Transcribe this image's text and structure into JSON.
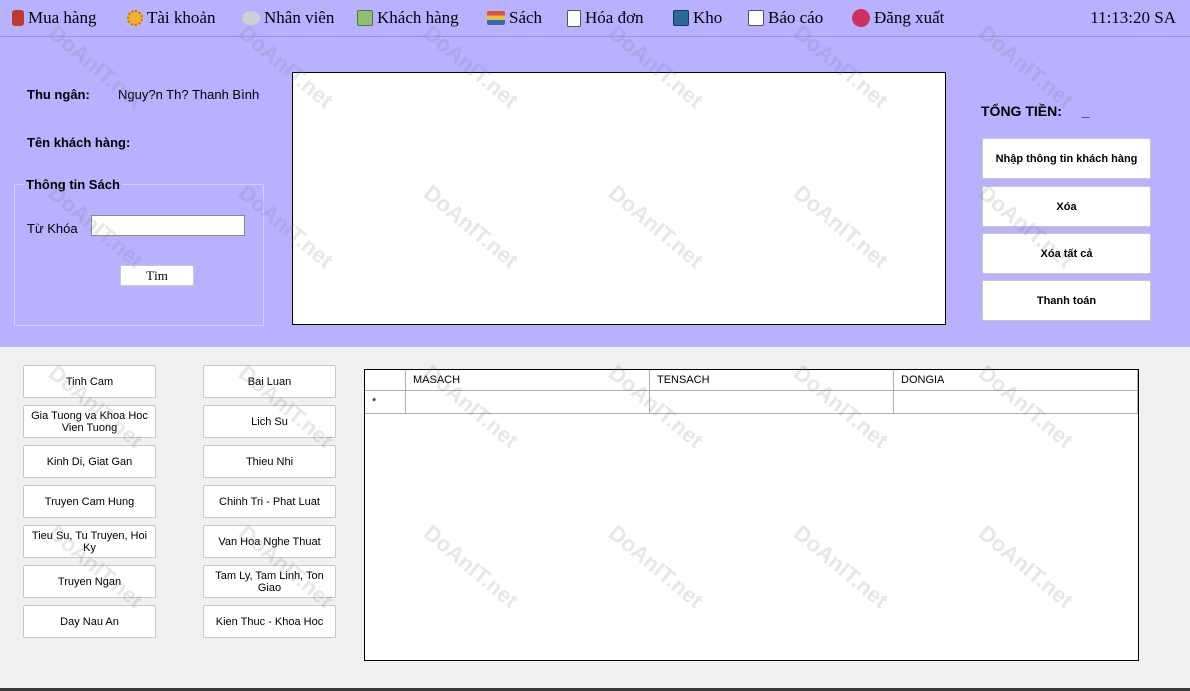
{
  "menu": {
    "items": [
      {
        "label": "Mua hàng",
        "icon": "shopping-icon",
        "color": "#c0392b"
      },
      {
        "label": "Tài khoản",
        "icon": "gear-icon",
        "color": "#e0a020"
      },
      {
        "label": "Nhân viên",
        "icon": "employees-icon",
        "color": "#8a8a8a"
      },
      {
        "label": "Khách hàng",
        "icon": "customer-icon",
        "color": "#4a8a3a"
      },
      {
        "label": "Sách",
        "icon": "books-icon",
        "color": "#3a6ab0"
      },
      {
        "label": "Hóa đơn",
        "icon": "invoice-icon",
        "color": "#6a6a6a"
      },
      {
        "label": "Kho",
        "icon": "warehouse-icon",
        "color": "#2a6a9a"
      },
      {
        "label": "Báo cáo",
        "icon": "report-icon",
        "color": "#7a7a7a"
      },
      {
        "label": "Đăng xuất",
        "icon": "logout-icon",
        "color": "#d03060"
      }
    ],
    "clock": "11:13:20 SA"
  },
  "cashier": {
    "label": "Thu ngân:",
    "value": "Nguy?n Th? Thanh Bình"
  },
  "customer": {
    "label": "Tên khách hàng:"
  },
  "book_info": {
    "title": "Thông tin Sách",
    "keyword_label": "Từ Khóa",
    "keyword_value": "",
    "search_button": "Tìm"
  },
  "total": {
    "label": "TỔNG TIỀN:",
    "value": "_"
  },
  "actions": {
    "enter_customer": "Nhập thông tin khách hàng",
    "delete": "Xóa",
    "delete_all": "Xóa tất cả",
    "pay": "Thanh toán"
  },
  "categories_left": [
    "Tinh Cam",
    "Gia Tuong va Khoa Hoc Vien Tuong",
    "Kinh Di, Giat Gan",
    "Truyen Cam Hung",
    "Tieu Su, Tu Truyen, Hoi Ky",
    "Truyen Ngan",
    "Day Nau An"
  ],
  "categories_right": [
    "Bai Luan",
    "Lich Su",
    "Thieu Nhi",
    "Chinh Tri - Phat Luat",
    "Van Hoa Nghe Thuat",
    "Tam Ly, Tam Linh, Ton Giao",
    "Kien Thuc - Khoa Hoc"
  ],
  "grid": {
    "columns": [
      "MASACH",
      "TENSACH",
      "DONGIA"
    ],
    "new_row_marker": "*"
  },
  "watermark": {
    "text": "DoAnIT.net"
  }
}
